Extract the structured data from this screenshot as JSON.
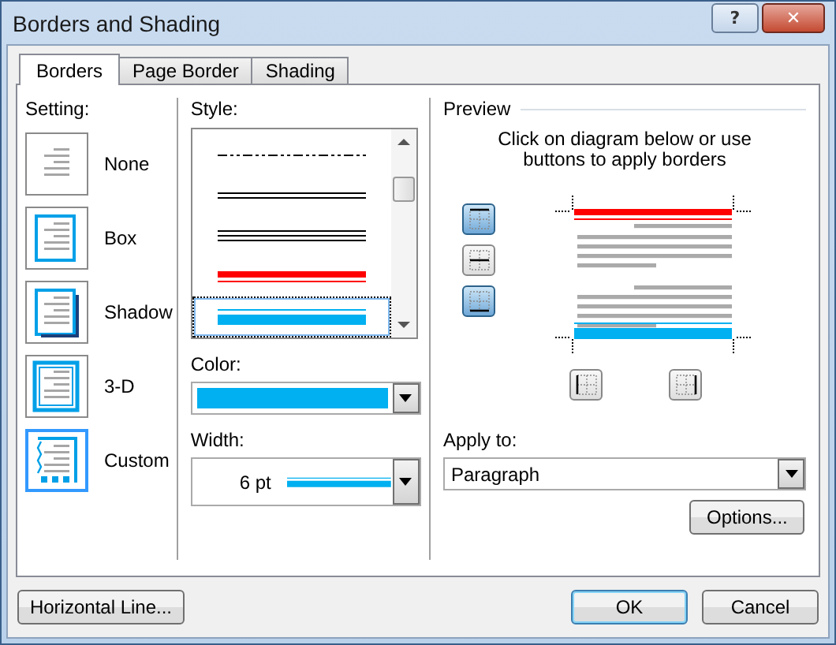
{
  "window": {
    "title": "Borders and Shading",
    "controls": [
      {
        "kind": "help",
        "label": "?"
      },
      {
        "kind": "close",
        "label": "✕"
      }
    ]
  },
  "tabs": [
    {
      "label": "Borders",
      "selected": true
    },
    {
      "label": "Page Border",
      "selected": false
    },
    {
      "label": "Shading",
      "selected": false
    }
  ],
  "setting": {
    "label": "Setting:",
    "options": [
      {
        "kind": "none",
        "label": "None",
        "selected": false
      },
      {
        "kind": "box",
        "label": "Box",
        "selected": false
      },
      {
        "kind": "shadow",
        "label": "Shadow",
        "selected": false
      },
      {
        "kind": "threed",
        "label": "3-D",
        "selected": false
      },
      {
        "kind": "custom",
        "label": "Custom",
        "selected": true
      }
    ]
  },
  "style": {
    "label": "Style:",
    "options": [
      {
        "kind": "dash_dot_dot",
        "color": "#000000",
        "selected": false
      },
      {
        "kind": "double",
        "color": "#000000",
        "selected": false
      },
      {
        "kind": "triple",
        "color": "#000000",
        "selected": false
      },
      {
        "kind": "thick_thin",
        "color": "#ff0000",
        "selected": false
      },
      {
        "kind": "thin_thick",
        "color": "#00b0f0",
        "selected": true
      }
    ]
  },
  "color": {
    "label": "Color:",
    "color": "#00b0f0"
  },
  "width": {
    "label": "Width:",
    "value": "6 pt"
  },
  "preview": {
    "title": "Preview",
    "hint": "Click on diagram below or use buttons to apply borders",
    "border_buttons": [
      {
        "kind": "top",
        "selected": true
      },
      {
        "kind": "inside_horizontal",
        "selected": false
      },
      {
        "kind": "bottom",
        "selected": true
      },
      {
        "kind": "left",
        "selected": false
      },
      {
        "kind": "right",
        "selected": false
      }
    ],
    "diagram": {
      "top": {
        "kind": "thick_thin",
        "color": "#ff0000"
      },
      "bottom": {
        "kind": "thin_thick",
        "color": "#00b0f0"
      }
    }
  },
  "apply_to": {
    "label": "Apply to:",
    "value": "Paragraph"
  },
  "options_button": "Options...",
  "footer": {
    "left_button": "Horizontal Line...",
    "ok": "OK",
    "cancel": "Cancel"
  }
}
